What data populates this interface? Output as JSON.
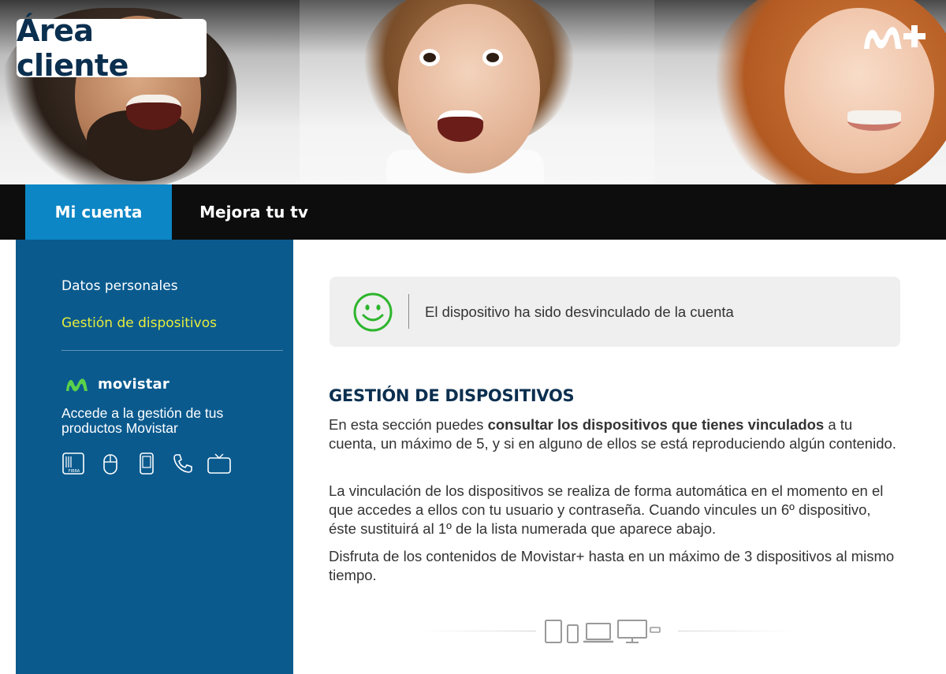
{
  "header": {
    "area_title": "Área cliente",
    "brand_logo": "M+"
  },
  "nav": {
    "tabs": [
      {
        "label": "Mi cuenta",
        "active": true
      },
      {
        "label": "Mejora tu tv",
        "active": false
      }
    ]
  },
  "sidebar": {
    "items": [
      {
        "label": "Datos personales",
        "active": false
      },
      {
        "label": "Gestión de dispositivos",
        "active": true
      }
    ],
    "movistar": {
      "brand": "movistar",
      "description": "Accede a la gestión de tus productos Movistar",
      "icons": [
        "fibra-icon",
        "mouse-icon",
        "mobile-icon",
        "phone-icon",
        "tv-icon"
      ],
      "fibra_label": "FIBRA"
    }
  },
  "notice": {
    "icon": "smiley-icon",
    "text": "El dispositivo ha sido desvinculado de la cuenta"
  },
  "main": {
    "title": "GESTIÓN DE DISPOSITIVOS",
    "p1_pre": "En esta sección puedes ",
    "p1_bold": "consultar los dispositivos que tienes vinculados",
    "p1_post": " a tu cuenta, un máximo de 5, y si en alguno de ellos se está reproduciendo algún contenido.",
    "p2": "La vinculación de los dispositivos se realiza de forma automática en el momento en el que accedes a ellos con tu usuario y contraseña. Cuando vincules un 6º dispositivo, éste sustituirá al 1º de la lista numerada que aparece abajo.",
    "p3": "Disfruta de los contenidos de Movistar+ hasta en un máximo de 3 dispositivos al mismo tiempo."
  },
  "colors": {
    "sidebar_bg": "#0a5a8e",
    "active_tab": "#0c86c5",
    "active_link": "#e6ec3b",
    "title": "#0b2f4f",
    "smiley": "#2db52d"
  }
}
